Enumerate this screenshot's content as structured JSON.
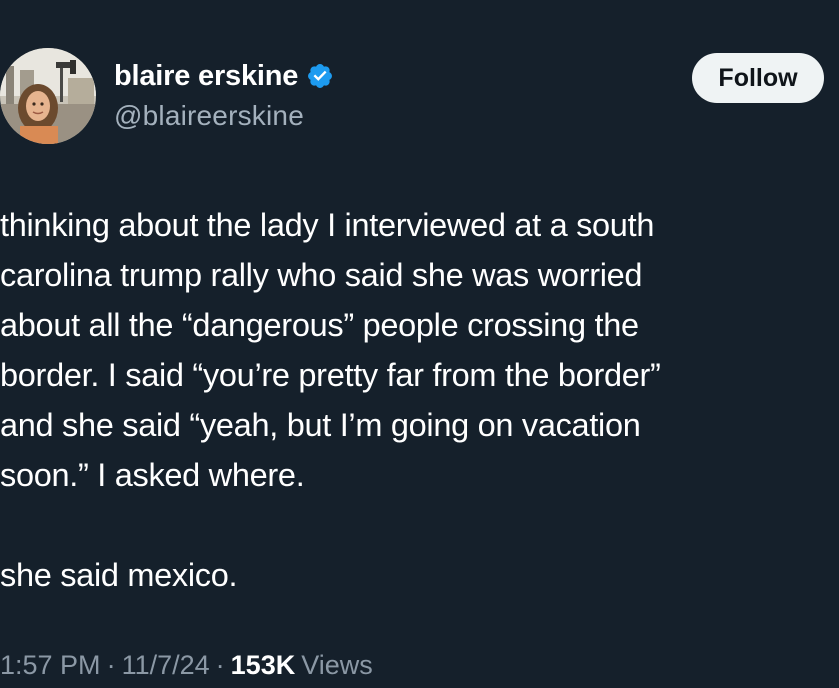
{
  "author": {
    "display_name": "blaire erskine",
    "handle": "@blaireerskine",
    "verified_icon": "verified-badge-icon"
  },
  "follow_button": {
    "label": "Follow"
  },
  "tweet": {
    "lines": [
      "thinking about the lady I interviewed at a south",
      "carolina trump rally who said she was worried",
      "about all the “dangerous” people crossing the",
      "border. I said “you’re pretty far from the border”",
      "and she said “yeah, but I’m going on vacation",
      "soon.” I asked where."
    ],
    "last_line": "she said mexico."
  },
  "meta": {
    "time": "1:57 PM",
    "separator": "·",
    "date": "11/7/24",
    "views_count": "153K",
    "views_label": "Views"
  },
  "colors": {
    "background": "#15202b",
    "text": "#ffffff",
    "secondary": "#8b98a5",
    "verified": "#1d9bf0",
    "button_bg": "#eff3f4"
  }
}
